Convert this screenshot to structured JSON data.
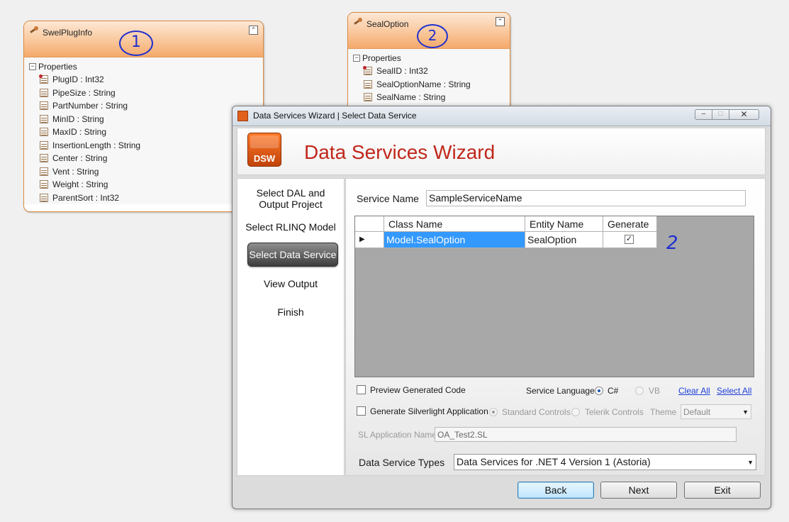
{
  "entity1": {
    "title": "SwelPlugInfo",
    "group": "Properties",
    "annotation": "1",
    "properties": [
      {
        "text": "PlugID : Int32",
        "key": true
      },
      {
        "text": "PipeSize : String",
        "key": false
      },
      {
        "text": "PartNumber : String",
        "key": false
      },
      {
        "text": "MinID : String",
        "key": false
      },
      {
        "text": "MaxID : String",
        "key": false
      },
      {
        "text": "InsertionLength : String",
        "key": false
      },
      {
        "text": "Center : String",
        "key": false
      },
      {
        "text": "Vent : String",
        "key": false
      },
      {
        "text": "Weight : String",
        "key": false
      },
      {
        "text": "ParentSort : Int32",
        "key": false
      }
    ]
  },
  "entity2": {
    "title": "SealOption",
    "group": "Properties",
    "annotation": "2",
    "properties": [
      {
        "text": "SealID : Int32",
        "key": true
      },
      {
        "text": "SealOptionName : String",
        "key": false
      },
      {
        "text": "SealName : String",
        "key": false
      }
    ]
  },
  "window": {
    "title": "Data Services Wizard | Select Data Service",
    "controls": {
      "minimize": "–",
      "maximize": "□",
      "close": "✕"
    }
  },
  "header": {
    "logo_text": "DSW",
    "title": "Data Services Wizard"
  },
  "nav": {
    "items": [
      "Select DAL and\nOutput Project",
      "Select RLINQ Model",
      "Select Data Service",
      "View Output",
      "Finish"
    ],
    "active_index": 2
  },
  "form": {
    "service_name_label": "Service Name",
    "service_name_value": "SampleServiceName",
    "grid": {
      "columns": [
        "Class Name",
        "Entity Name",
        "Generate"
      ],
      "rows": [
        {
          "class_name": "Model.SealOption",
          "entity_name": "SealOption",
          "generate": true
        }
      ],
      "annotation": "2"
    },
    "preview_code_label": "Preview Generated Code",
    "preview_code_checked": false,
    "service_language_label": "Service Language",
    "lang_csharp": "C#",
    "lang_vb": "VB",
    "selected_language": "C#",
    "clear_all": "Clear All",
    "select_all": "Select All",
    "silverlight_label": "Generate Silverlight Application",
    "silverlight_checked": false,
    "standard_controls": "Standard Controls",
    "telerik_controls": "Telerik Controls",
    "theme_label": "Theme",
    "theme_value": "Default",
    "sl_app_name_label": "SL Application Name",
    "sl_app_name_value": "OA_Test2.SL",
    "service_types_label": "Data Service Types",
    "service_types_value": "Data Services for .NET 4 Version 1 (Astoria)"
  },
  "footer": {
    "back": "Back",
    "next": "Next",
    "exit": "Exit"
  },
  "colors": {
    "accent_red": "#c1271b",
    "entity_orange": "#f4a96a",
    "selection_blue": "#3399ff",
    "annotation_blue": "#1f2fd0"
  }
}
